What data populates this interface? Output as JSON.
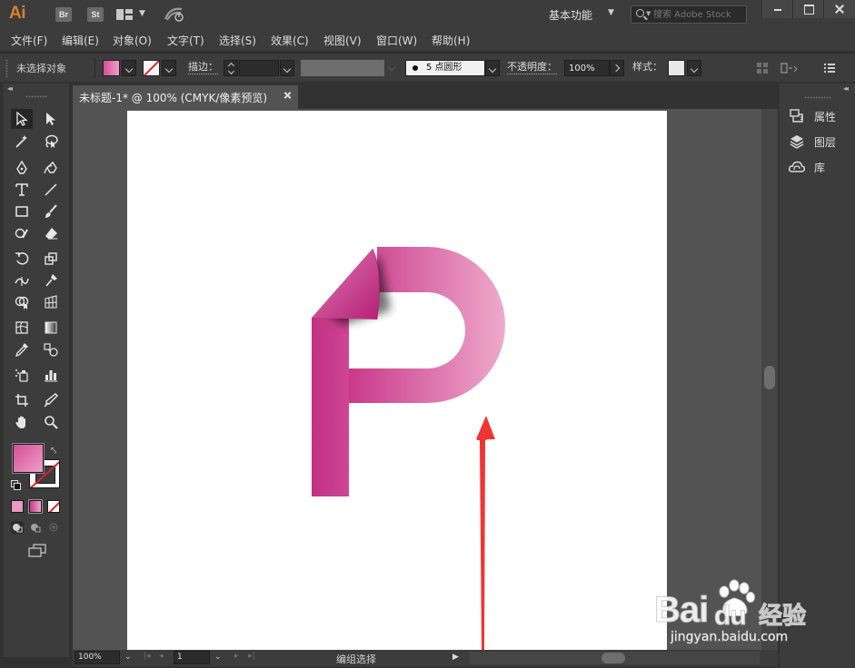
{
  "app": {
    "logo": "Ai",
    "bridge": "Br",
    "stock_app": "St",
    "workspace": "基本功能",
    "search_placeholder": "搜索 Adobe Stock"
  },
  "menu": [
    {
      "id": "file",
      "label": "文件(F)"
    },
    {
      "id": "edit",
      "label": "编辑(E)"
    },
    {
      "id": "object",
      "label": "对象(O)"
    },
    {
      "id": "type",
      "label": "文字(T)"
    },
    {
      "id": "select",
      "label": "选择(S)"
    },
    {
      "id": "effect",
      "label": "效果(C)"
    },
    {
      "id": "view",
      "label": "视图(V)"
    },
    {
      "id": "window",
      "label": "窗口(W)"
    },
    {
      "id": "help",
      "label": "帮助(H)"
    }
  ],
  "control": {
    "selection_status": "未选择对象",
    "stroke_label": "描边：",
    "brush_size": "5",
    "brush_name": "点圆形",
    "opacity_label": "不透明度：",
    "opacity_value": "100%",
    "style_label": "样式："
  },
  "document": {
    "tab_title": "未标题-1* @ 100% (CMYK/像素预览)"
  },
  "status": {
    "zoom": "100%",
    "page": "1",
    "tool_status": "编组选择"
  },
  "panels": [
    {
      "id": "properties",
      "label": "属性",
      "icon": "properties-icon"
    },
    {
      "id": "layers",
      "label": "图层",
      "icon": "layers-icon"
    },
    {
      "id": "libraries",
      "label": "库",
      "icon": "libraries-icon"
    }
  ],
  "artwork": {
    "letter_gradient_start": "#c9378a",
    "letter_gradient_end": "#eeaacb",
    "arrow_color": "#f03434"
  },
  "watermark": {
    "brand_latin": "Bai",
    "brand_latin_suffix": "du",
    "brand_cn": "经验",
    "url": "jingyan.baidu.com"
  }
}
